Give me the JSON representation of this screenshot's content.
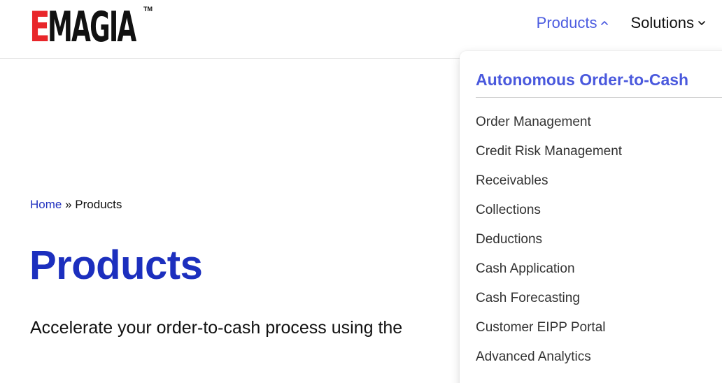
{
  "header": {
    "logo": {
      "first_letter": "E",
      "rest": "MAGIA",
      "trademark": "TM"
    },
    "nav": [
      {
        "label": "Products",
        "state": "open"
      },
      {
        "label": "Solutions",
        "state": "closed"
      }
    ]
  },
  "breadcrumb": {
    "home": "Home",
    "separator": "»",
    "current": "Products"
  },
  "page": {
    "title": "Products",
    "lead": "Accelerate your order-to-cash process using the"
  },
  "dropdown": {
    "heading": "Autonomous Order-to-Cash",
    "items": [
      "Order Management",
      "Credit Risk Management",
      "Receivables",
      "Collections",
      "Deductions",
      "Cash Application",
      "Cash Forecasting",
      "Customer EIPP Portal",
      "Advanced Analytics"
    ]
  },
  "colors": {
    "brand_red": "#e8262a",
    "accent_blue": "#4c5ce0",
    "title_blue": "#1c2fbe",
    "link_blue": "#2434c0"
  }
}
